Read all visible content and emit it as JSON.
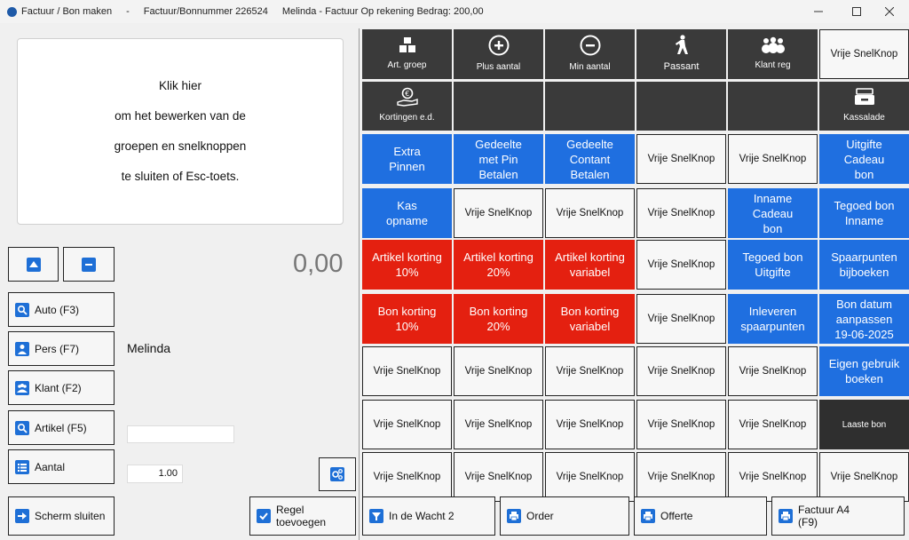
{
  "titlebar": {
    "title": "Factuur / Bon  maken",
    "separator": "-",
    "invoice": "Factuur/Bonnummer  226524",
    "customer": "Melinda  -  Factuur Op rekening  Bedrag: 200,00"
  },
  "info": {
    "lines": [
      "Klik hier",
      "om het bewerken van de",
      "groepen en snelknoppen",
      "te sluiten of Esc-toets."
    ]
  },
  "left": {
    "amount": "0,00",
    "person_name": "Melinda",
    "quantity": "1.00",
    "buttons": {
      "auto": "Auto (F3)",
      "pers": "Pers (F7)",
      "klant": "Klant (F2)",
      "artikel": "Artikel (F5)",
      "aantal": "Aantal",
      "scherm_sluiten": "Scherm sluiten",
      "regel_1": "Regel",
      "regel_2": "toevoegen"
    }
  },
  "grid": {
    "row1": [
      "Art. groep",
      "Plus aantal",
      "Min aantal",
      "Passant",
      "Klant reg",
      "Vrije SnelKnop"
    ],
    "row2": [
      "Kortingen e.d.",
      "Kassalade"
    ],
    "row3": [
      [
        "Extra",
        "Pinnen"
      ],
      [
        "Gedeelte",
        "met Pin",
        "Betalen"
      ],
      [
        "Gedeelte",
        "Contant",
        "Betalen"
      ],
      [
        "Vrije SnelKnop"
      ],
      [
        "Vrije SnelKnop"
      ],
      [
        "Uitgifte",
        "Cadeau",
        "bon"
      ]
    ],
    "row4": [
      [
        "Kas",
        "opname"
      ],
      [
        "Vrije SnelKnop"
      ],
      [
        "Vrije SnelKnop"
      ],
      [
        "Vrije SnelKnop"
      ],
      [
        "Inname",
        "Cadeau",
        "bon"
      ],
      [
        "Tegoed bon",
        "Inname"
      ]
    ],
    "row5": [
      [
        "Artikel korting",
        "10%"
      ],
      [
        "Artikel korting",
        "20%"
      ],
      [
        "Artikel korting",
        "variabel"
      ],
      [
        "Vrije SnelKnop"
      ],
      [
        "Tegoed bon",
        "Uitgifte"
      ],
      [
        "Spaarpunten",
        "bijboeken"
      ]
    ],
    "row6": [
      [
        "Bon korting",
        "10%"
      ],
      [
        "Bon korting",
        "20%"
      ],
      [
        "Bon korting",
        "variabel"
      ],
      [
        "Vrije SnelKnop"
      ],
      [
        "Inleveren",
        "spaarpunten"
      ],
      [
        "Bon datum",
        "aanpassen",
        "19-06-2025"
      ]
    ],
    "row7": [
      [
        "Vrije SnelKnop"
      ],
      [
        "Vrije SnelKnop"
      ],
      [
        "Vrije SnelKnop"
      ],
      [
        "Vrije SnelKnop"
      ],
      [
        "Vrije SnelKnop"
      ],
      [
        "Eigen gebruik",
        "boeken"
      ]
    ],
    "row8": [
      [
        "Vrije SnelKnop"
      ],
      [
        "Vrije SnelKnop"
      ],
      [
        "Vrije SnelKnop"
      ],
      [
        "Vrije SnelKnop"
      ],
      [
        "Vrije SnelKnop"
      ],
      [
        "Laaste bon"
      ]
    ],
    "row9": [
      [
        "Vrije SnelKnop"
      ],
      [
        "Vrije SnelKnop"
      ],
      [
        "Vrije SnelKnop"
      ],
      [
        "Vrije SnelKnop"
      ],
      [
        "Vrije SnelKnop"
      ],
      [
        "Vrije SnelKnop"
      ]
    ]
  },
  "bottom": {
    "wacht": "In de Wacht 2",
    "order": "Order",
    "offerte": "Offerte",
    "factuur_1": "Factuur A4",
    "factuur_2": "(F9)"
  },
  "colors": {
    "blue": "#1f6fe0",
    "red": "#e42010",
    "dark": "#3a3a3a",
    "icon_blue": "#1e6fd6"
  }
}
